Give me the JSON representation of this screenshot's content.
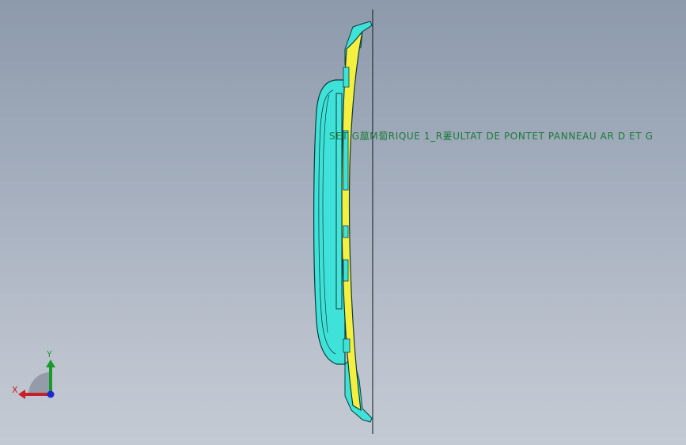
{
  "viewport": {
    "background_top": "#8d9aab",
    "background_bottom": "#c4cad4"
  },
  "part": {
    "body_color": "#3fe2d8",
    "edge_color": "#0c3a3a",
    "flange_color": "#f5f040"
  },
  "annotation": {
    "text": "SET G蓏M蔔RIQUE 1_R蓌ULTAT DE PONTET PANNEAU AR D ET G",
    "color": "#1a7a3a"
  },
  "triad": {
    "x_label": "X",
    "y_label": "Y",
    "x_color": "#c8202a",
    "y_color": "#1a9a2a",
    "z_color": "#1a2ad0"
  }
}
